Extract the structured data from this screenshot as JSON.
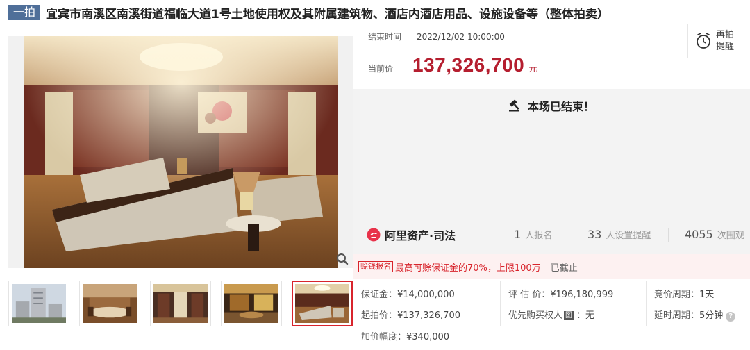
{
  "title": {
    "round_badge": "一拍",
    "text": "宜宾市南溪区南溪街道福临大道1号土地使用权及其附属建筑物、酒店内酒店用品、设施设备等（整体拍卖）"
  },
  "auction": {
    "end_time_label": "结束时间",
    "end_time_value": "2022/12/02 10:00:00",
    "price_label": "当前价",
    "price_value": "137,326,700",
    "price_unit": "元",
    "remind_label_1": "再拍",
    "remind_label_2": "提醒",
    "ended_text": "本场已结束！"
  },
  "stats": {
    "platform_name": "阿里资产·司法",
    "signup_count": "1",
    "signup_label": "人报名",
    "remind_count": "33",
    "remind_label": "人设置提醒",
    "view_count": "4055",
    "view_label": "次围观"
  },
  "deposit": {
    "tag": "赊钱报名",
    "text": "最高可赊保证金的70%，上限100万",
    "status": "已截止"
  },
  "details": {
    "deposit_label": "保证金：",
    "deposit_value": "¥14,000,000",
    "appraisal_label": "评 估 价：",
    "appraisal_value": "¥196,180,999",
    "bid_cycle_label": "竞价周期：",
    "bid_cycle_value": "1天",
    "start_price_label": "起拍价：",
    "start_price_value": "¥137,326,700",
    "priority_label": "优先购买权人",
    "priority_tag": "图",
    "priority_value": "：无",
    "delay_label": "延时周期：",
    "delay_value": "5分钟",
    "increment_label": "加价幅度：",
    "increment_value": "¥340,000"
  },
  "images": {
    "main_alt": "酒店大堂沙发区",
    "thumbnails": [
      "building-exterior",
      "dining-room",
      "corridor",
      "lounge",
      "lobby-sofa"
    ],
    "active_thumbnail": 4
  },
  "colors": {
    "accent_red": "#b51e2f",
    "badge_blue": "#4f6f99",
    "banner_pink": "#fdf1f1"
  }
}
